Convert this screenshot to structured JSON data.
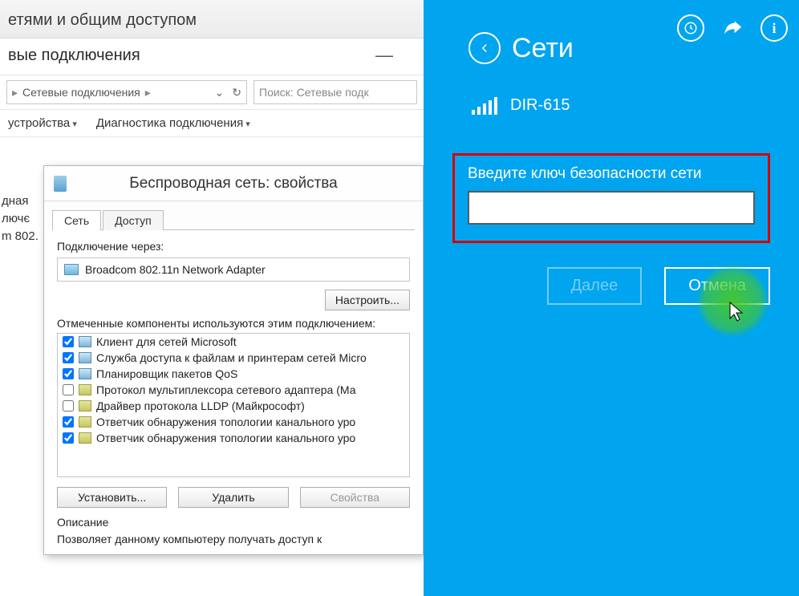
{
  "explorer": {
    "title": "етями и общим доступом",
    "subtitle": "вые подключения",
    "breadcrumb": "Сетевые подключения",
    "search_placeholder": "Поиск: Сетевые подк",
    "toolbar": {
      "item1": "устройства",
      "item2": "Диагностика подключения"
    },
    "frag1": "дная",
    "frag2": "лючє",
    "frag3": "m 802."
  },
  "props": {
    "title": "Беспроводная сеть: свойства",
    "tab_network": "Сеть",
    "tab_access": "Доступ",
    "connect_via": "Подключение через:",
    "adapter": "Broadcom 802.11n Network Adapter",
    "configure_btn": "Настроить...",
    "components_label": "Отмеченные компоненты используются этим подключением:",
    "components": [
      {
        "checked": true,
        "icon": "net",
        "label": "Клиент для сетей Microsoft"
      },
      {
        "checked": true,
        "icon": "net",
        "label": "Служба доступа к файлам и принтерам сетей Micro"
      },
      {
        "checked": true,
        "icon": "net",
        "label": "Планировщик пакетов QoS"
      },
      {
        "checked": false,
        "icon": "svc",
        "label": "Протокол мультиплексора сетевого адаптера (Ма"
      },
      {
        "checked": false,
        "icon": "svc",
        "label": "Драйвер протокола LLDP (Майкрософт)"
      },
      {
        "checked": true,
        "icon": "svc",
        "label": "Ответчик обнаружения топологии канального уро"
      },
      {
        "checked": true,
        "icon": "svc",
        "label": "Ответчик обнаружения топологии канального уро"
      }
    ],
    "install_btn": "Установить...",
    "remove_btn": "Удалить",
    "props_btn": "Свойства",
    "desc_heading": "Описание",
    "desc_text": "Позволяет данному компьютеру получать доступ к"
  },
  "charm": {
    "header": "Сети",
    "network_name": "DIR-615",
    "key_label": "Введите ключ безопасности сети",
    "key_value": "",
    "next_btn": "Далее",
    "cancel_btn": "Отмена"
  }
}
